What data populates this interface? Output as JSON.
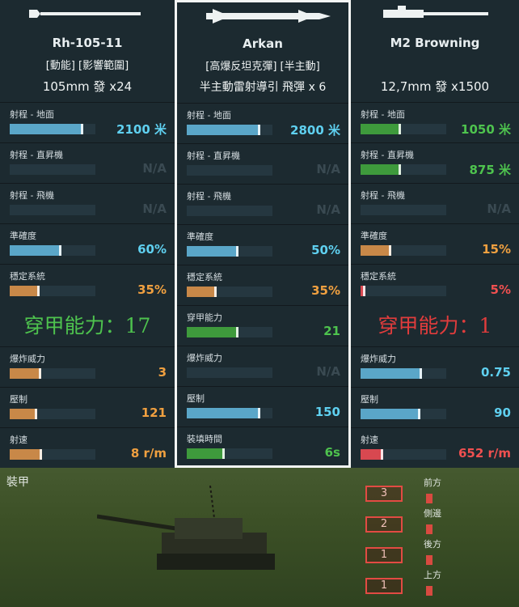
{
  "colors": {
    "blue": "#5aa6c8",
    "green": "#3e9a3c",
    "orange": "#c88848",
    "red": "#d84850",
    "cyan_text": "#5fd0f0",
    "green_text": "#4ec34e",
    "orange_text": "#f0a040",
    "red_text": "#f05050"
  },
  "weapons": [
    {
      "name": "Rh-105-11",
      "tags": "[動能] [影響範圍]",
      "ammo": "105mm 發 x24",
      "icon": "tank-gun-icon",
      "stats": [
        {
          "label": "射程 - 地面",
          "value": "2100 米",
          "fill": 0.86,
          "color": "blue",
          "vcolor": "cyan_text"
        },
        {
          "label": "射程 - 直昇機",
          "value": "N/A",
          "fill": 0,
          "color": "blue",
          "vcolor": "na"
        },
        {
          "label": "射程 - 飛機",
          "value": "N/A",
          "fill": 0,
          "color": "blue",
          "vcolor": "na"
        },
        {
          "label": "準確度",
          "value": "60%",
          "fill": 0.6,
          "color": "blue",
          "vcolor": "cyan_text"
        },
        {
          "label": "穩定系統",
          "value": "35%",
          "fill": 0.35,
          "color": "orange",
          "vcolor": "orange_text"
        }
      ],
      "penetration": "穿甲能力：17",
      "stats2": [
        {
          "label": "爆炸威力",
          "value": "3",
          "fill": 0.37,
          "color": "orange",
          "vcolor": "orange_text"
        },
        {
          "label": "壓制",
          "value": "121",
          "fill": 0.32,
          "color": "orange",
          "vcolor": "orange_text"
        },
        {
          "label": "射速",
          "value": "8 r/m",
          "fill": 0.38,
          "color": "orange",
          "vcolor": "orange_text"
        }
      ]
    },
    {
      "name": "Arkan",
      "tags": "[高爆反坦克彈] [半主動]",
      "ammo": "半主動雷射導引 飛彈 x 6",
      "icon": "missile-icon",
      "stats": [
        {
          "label": "射程 - 地面",
          "value": "2800 米",
          "fill": 0.86,
          "color": "blue",
          "vcolor": "cyan_text"
        },
        {
          "label": "射程 - 直昇機",
          "value": "N/A",
          "fill": 0,
          "color": "blue",
          "vcolor": "na"
        },
        {
          "label": "射程 - 飛機",
          "value": "N/A",
          "fill": 0,
          "color": "blue",
          "vcolor": "na"
        },
        {
          "label": "準確度",
          "value": "50%",
          "fill": 0.6,
          "color": "blue",
          "vcolor": "cyan_text"
        },
        {
          "label": "穩定系統",
          "value": "35%",
          "fill": 0.35,
          "color": "orange",
          "vcolor": "orange_text"
        },
        {
          "label": "穿甲能力",
          "value": "21",
          "fill": 0.6,
          "color": "green",
          "vcolor": "green_text"
        },
        {
          "label": "爆炸威力",
          "value": "N/A",
          "fill": 0,
          "color": "orange",
          "vcolor": "na"
        },
        {
          "label": "壓制",
          "value": "150",
          "fill": 0.86,
          "color": "blue",
          "vcolor": "cyan_text"
        },
        {
          "label": "裝填時間",
          "value": "6s",
          "fill": 0.44,
          "color": "green",
          "vcolor": "green_text"
        }
      ]
    },
    {
      "name": "M2 Browning",
      "tags": "",
      "ammo": "12,7mm 發 x1500",
      "icon": "machine-gun-icon",
      "stats": [
        {
          "label": "射程 - 地面",
          "value": "1050 米",
          "fill": 0.47,
          "color": "green",
          "vcolor": "green_text"
        },
        {
          "label": "射程 - 直昇機",
          "value": "875 米",
          "fill": 0.47,
          "color": "green",
          "vcolor": "green_text"
        },
        {
          "label": "射程 - 飛機",
          "value": "N/A",
          "fill": 0,
          "color": "blue",
          "vcolor": "na"
        },
        {
          "label": "準確度",
          "value": "15%",
          "fill": 0.36,
          "color": "orange",
          "vcolor": "orange_text"
        },
        {
          "label": "穩定系統",
          "value": "5%",
          "fill": 0.06,
          "color": "red",
          "vcolor": "red_text"
        }
      ],
      "penetration": "穿甲能力：1",
      "stats2": [
        {
          "label": "爆炸威力",
          "value": "0.75",
          "fill": 0.72,
          "color": "blue",
          "vcolor": "cyan_text"
        },
        {
          "label": "壓制",
          "value": "90",
          "fill": 0.7,
          "color": "blue",
          "vcolor": "cyan_text"
        },
        {
          "label": "射速",
          "value": "652 r/m",
          "fill": 0.26,
          "color": "red",
          "vcolor": "red_text"
        }
      ]
    }
  ],
  "armor": {
    "label": "裝甲",
    "sides": [
      {
        "value": "3",
        "label": "前方"
      },
      {
        "value": "2",
        "label": "側邊"
      },
      {
        "value": "1",
        "label": "後方"
      },
      {
        "value": "1",
        "label": "上方"
      }
    ]
  }
}
